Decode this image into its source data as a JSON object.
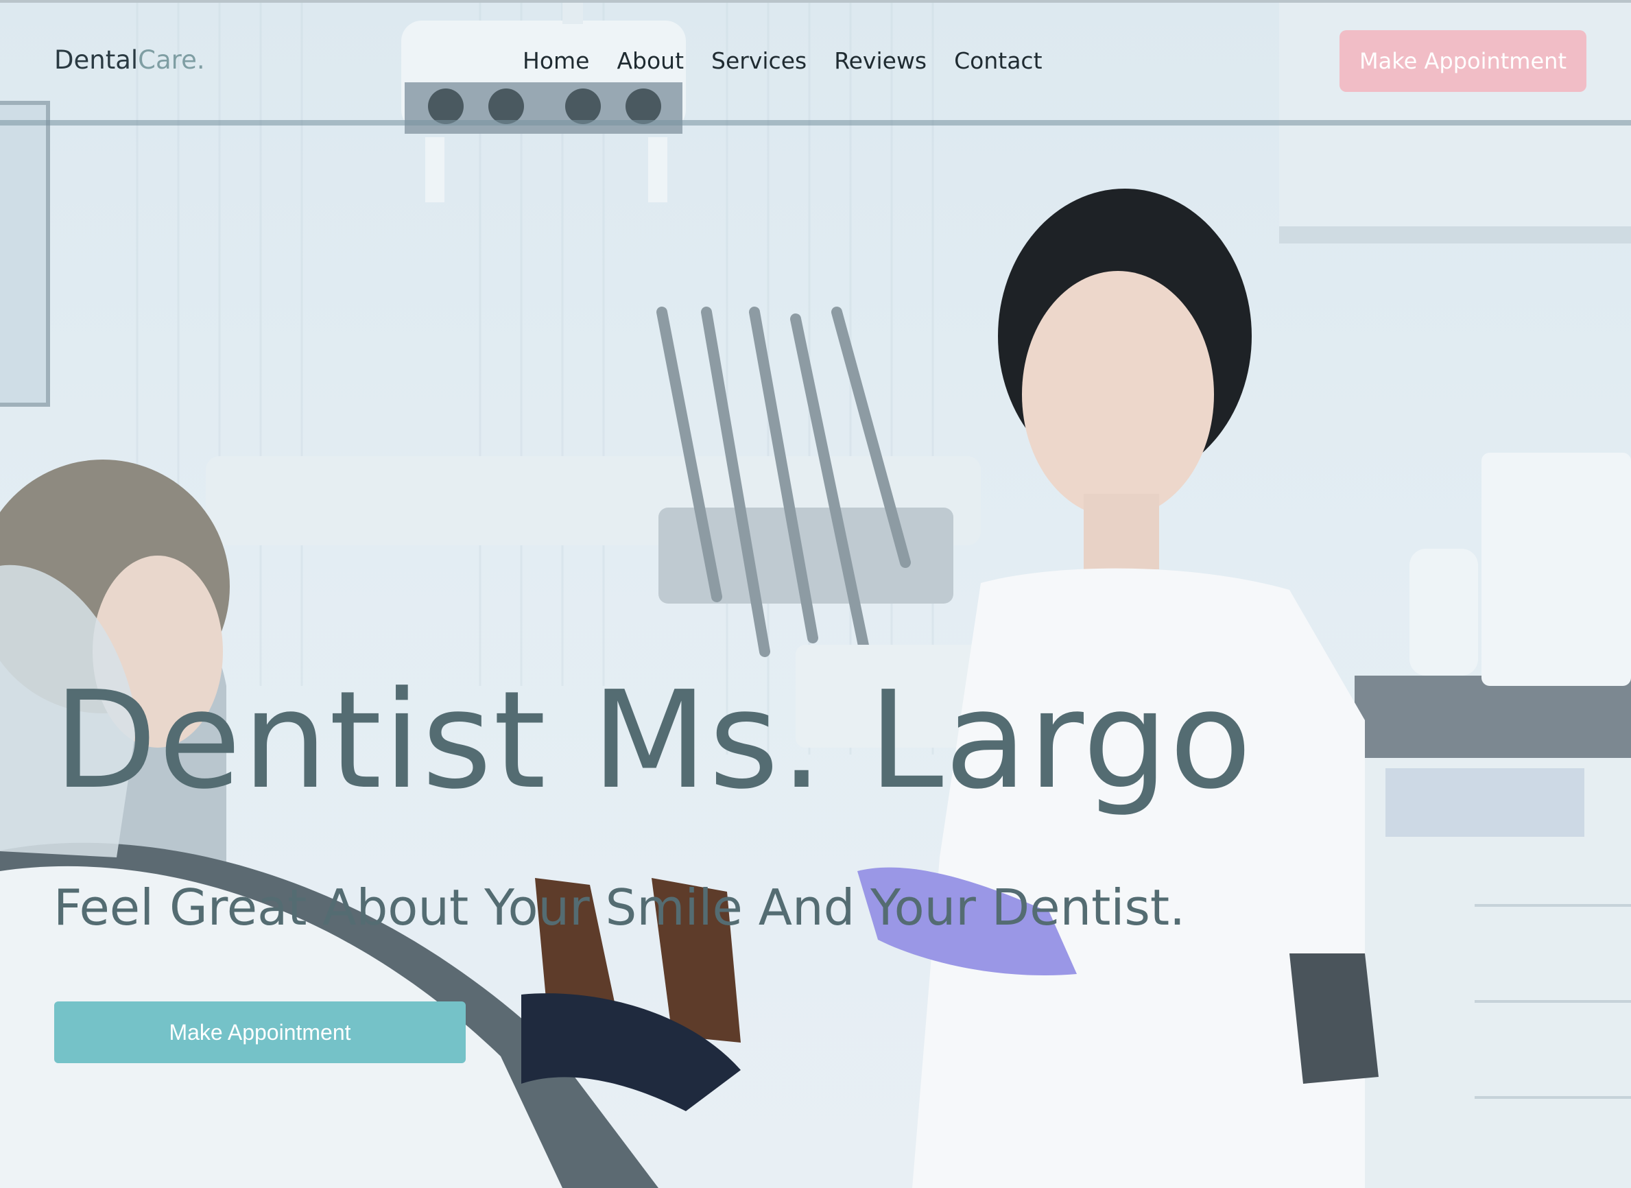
{
  "logo": {
    "main": "Dental",
    "accent": "Care."
  },
  "nav": {
    "links": [
      "Home",
      "About",
      "Services",
      "Reviews",
      "Contact"
    ],
    "cta_label": "Make Appointment"
  },
  "hero": {
    "title": "Dentist Ms. Largo",
    "subtitle": "Feel Great About Your Smile And Your Dentist.",
    "cta_label": "Make Appointment"
  },
  "colors": {
    "accent": "#7f9ea3",
    "nav_cta": "#f1bdc6",
    "hero_cta": "#75c2c8",
    "hero_text": "#546c72"
  }
}
